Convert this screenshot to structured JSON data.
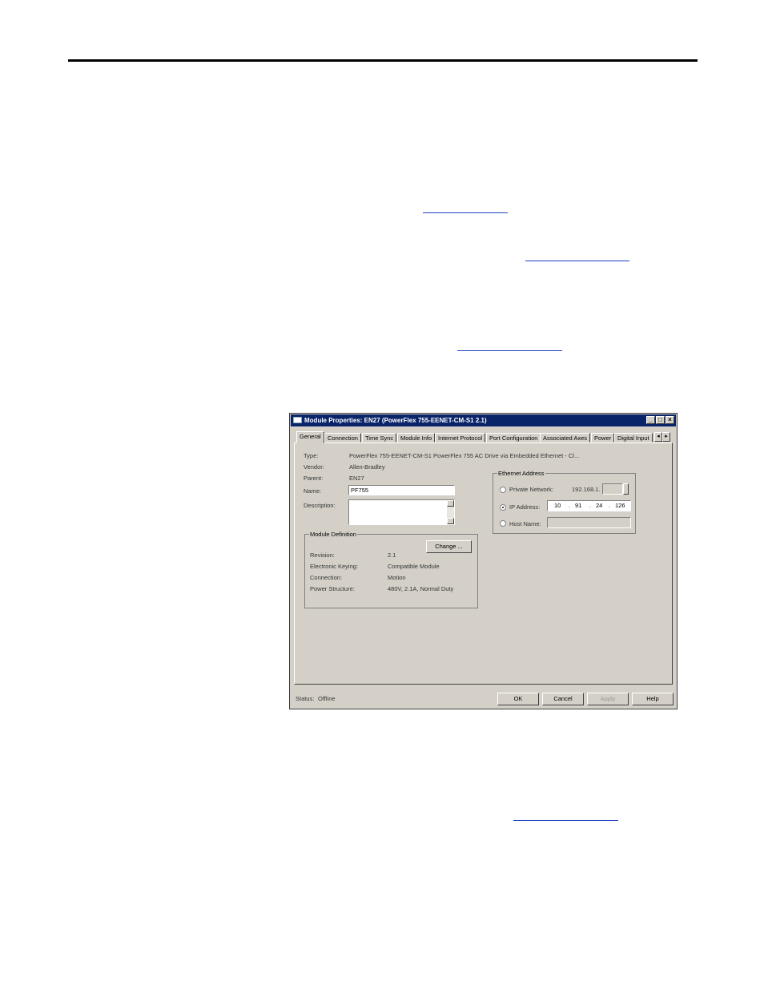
{
  "dialog": {
    "title": "Module Properties: EN27 (PowerFlex 755-EENET-CM-S1 2.1)",
    "tabs": [
      "General",
      "Connection",
      "Time Sync",
      "Module Info",
      "Internet Protocol",
      "Port Configuration",
      "Associated Axes",
      "Power",
      "Digital Input"
    ],
    "active_tab": "General",
    "general": {
      "type_label": "Type:",
      "type_value": "PowerFlex 755-EENET-CM-S1 PowerFlex 755 AC Drive via Embedded Ethernet - Cl...",
      "vendor_label": "Vendor:",
      "vendor_value": "Allen-Bradley",
      "parent_label": "Parent:",
      "parent_value": "EN27",
      "name_label": "Name:",
      "name_value": "PF755",
      "description_label": "Description:",
      "description_value": ""
    },
    "module_definition": {
      "title": "Module Definition",
      "change_label": "Change ...",
      "revision_label": "Revision:",
      "revision_value": "2.1",
      "keying_label": "Electronic Keying:",
      "keying_value": "Compatible Module",
      "connection_label": "Connection:",
      "connection_value": "Motion",
      "power_label": "Power Structure:",
      "power_value": "480V, 2.1A, Normal Duty"
    },
    "ethernet": {
      "title": "Ethernet Address",
      "private_label": "Private Network:",
      "private_prefix": "192.168.1.",
      "ip_label": "IP Address:",
      "ip_octets": [
        "10",
        "91",
        "24",
        "126"
      ],
      "host_label": "Host Name:",
      "selected": "ip"
    },
    "status_label": "Status:",
    "status_value": "Offline",
    "buttons": {
      "ok": "OK",
      "cancel": "Cancel",
      "apply": "Apply",
      "help": "Help"
    }
  }
}
